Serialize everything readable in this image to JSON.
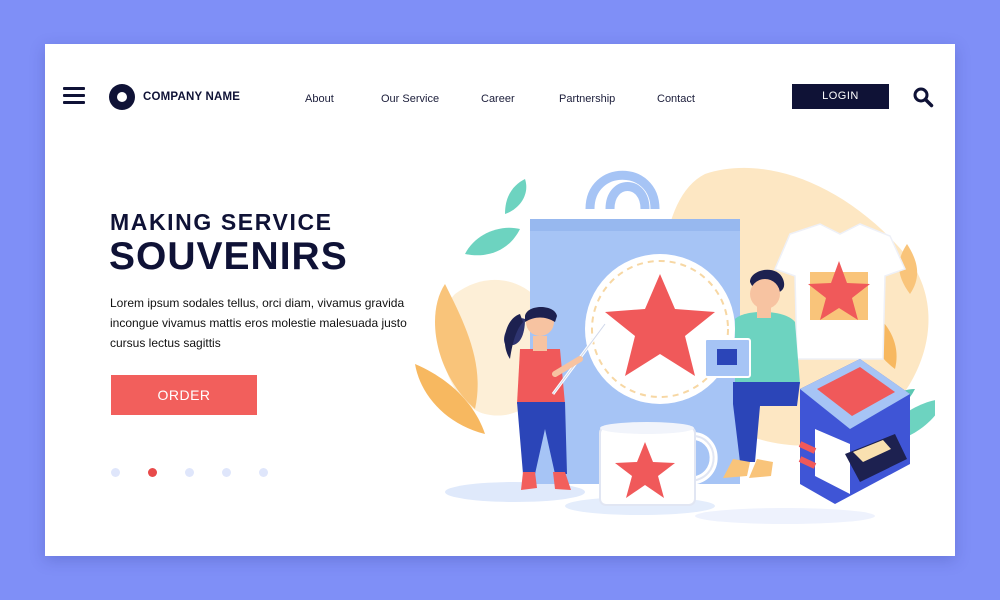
{
  "header": {
    "company_name": "COMPANY NAME",
    "nav": [
      "About",
      "Our Service",
      "Career",
      "Partnership",
      "Contact"
    ],
    "login_label": "LOGIN"
  },
  "hero": {
    "subtitle": "MAKING SERVICE",
    "title": "SOUVENIRS",
    "description": "Lorem ipsum sodales tellus, orci diam, vivamus gravida incongue vivamus mattis eros molestie malesuada justo cursus lectus sagittis",
    "order_label": "ORDER"
  },
  "carousel": {
    "count": 5,
    "active_index": 1
  },
  "colors": {
    "background": "#7f8ff7",
    "navy": "#0f1236",
    "accent": "#f25f5c",
    "bag": "#a6c4f5",
    "dot_inactive": "#dfe6fb"
  }
}
